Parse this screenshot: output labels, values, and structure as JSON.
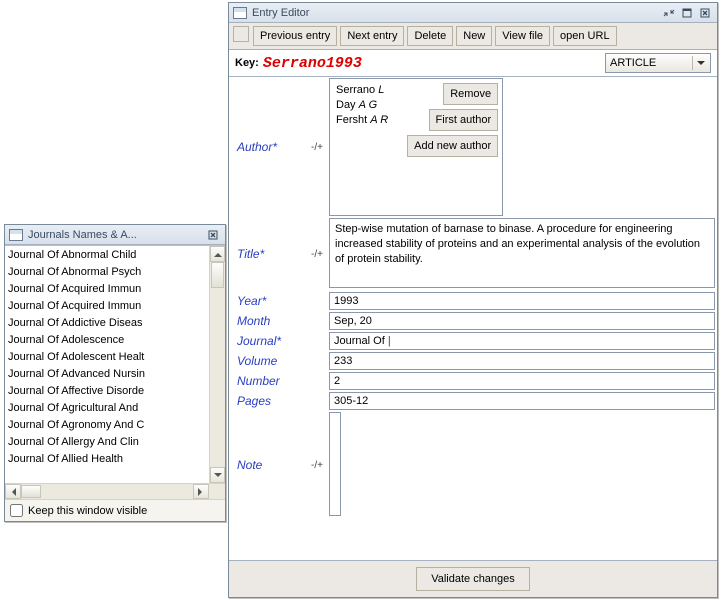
{
  "editor": {
    "title": "Entry Editor",
    "toolbar": {
      "prev": "Previous entry",
      "next": "Next entry",
      "delete": "Delete",
      "new": "New",
      "viewfile": "View file",
      "openurl": "open URL"
    },
    "key_label": "Key:",
    "key_value": "Serrano1993",
    "type_value": "ARTICLE",
    "fields": {
      "author_label": "Author*",
      "title_label": "Title*",
      "year_label": "Year*",
      "month_label": "Month",
      "journal_label": "Journal*",
      "volume_label": "Volume",
      "number_label": "Number",
      "pages_label": "Pages",
      "note_label": "Note",
      "pm": "-/+"
    },
    "authors": [
      {
        "surname": "Serrano",
        "initials": "L"
      },
      {
        "surname": "Day",
        "initials": "A G"
      },
      {
        "surname": "Fersht",
        "initials": "A R"
      }
    ],
    "author_btns": {
      "remove": "Remove",
      "first": "First author",
      "add": "Add new author"
    },
    "title_value": "Step-wise mutation of barnase to binase. A procedure for engineering increased stability of proteins and an experimental analysis of the evolution of protein stability.",
    "year_value": "1993",
    "month_value": "Sep, 20",
    "journal_value": "Journal Of ",
    "volume_value": "233",
    "number_value": "2",
    "pages_value": "305-12",
    "note_value": "",
    "validate": "Validate changes"
  },
  "journals": {
    "title": "Journals Names & A...",
    "items": [
      "Journal Of Abnormal Child",
      "Journal Of Abnormal Psych",
      "Journal Of Acquired Immun",
      "Journal Of Acquired Immun",
      "Journal Of Addictive Diseas",
      "Journal Of Adolescence",
      "Journal Of Adolescent Healt",
      "Journal Of Advanced Nursin",
      "Journal Of Affective Disorde",
      "Journal Of Agricultural And",
      "Journal Of Agronomy And C",
      "Journal Of Allergy And Clin",
      "Journal Of Allied Health"
    ],
    "keep_visible_label": "Keep this window visible"
  }
}
